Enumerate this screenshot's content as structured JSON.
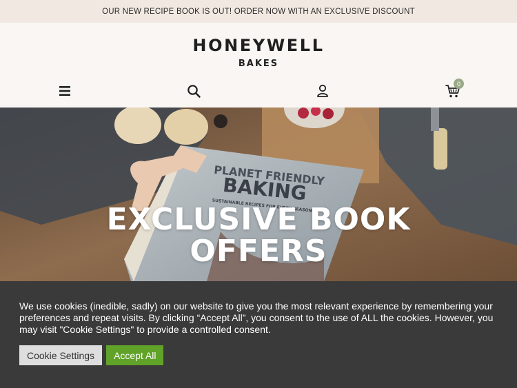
{
  "announcement": "OUR NEW RECIPE BOOK IS OUT! ORDER NOW WITH AN EXCLUSIVE DISCOUNT",
  "brand": {
    "name": "HONEYWELL",
    "sub": "BAKES"
  },
  "nav": {
    "icons": [
      "menu-icon",
      "search-icon",
      "user-icon",
      "cart-icon"
    ],
    "cart_count": "0"
  },
  "hero": {
    "title_line1": "EXCLUSIVE BOOK",
    "title_line2": "OFFERS",
    "book_title_line1": "PLANET FRIENDLY",
    "book_title_line2": "BAKING",
    "book_subtitle": "SUSTAINABLE RECIPES FOR EVERY SEASON"
  },
  "cookie": {
    "text": "We use cookies (inedible, sadly) on our website to give you the most relevant experience by remembering your preferences and repeat visits. By clicking “Accept All”, you consent to the use of ALL the cookies. However, you may visit \"Cookie Settings\" to provide a controlled consent.",
    "settings_label": "Cookie Settings",
    "accept_label": "Accept All"
  },
  "colors": {
    "announcement_bg": "#f1e9e1",
    "header_bg": "#f9f6f3",
    "cookie_bg": "#3a3a3a",
    "accept_green": "#61a229",
    "cart_badge": "#9aa987"
  }
}
